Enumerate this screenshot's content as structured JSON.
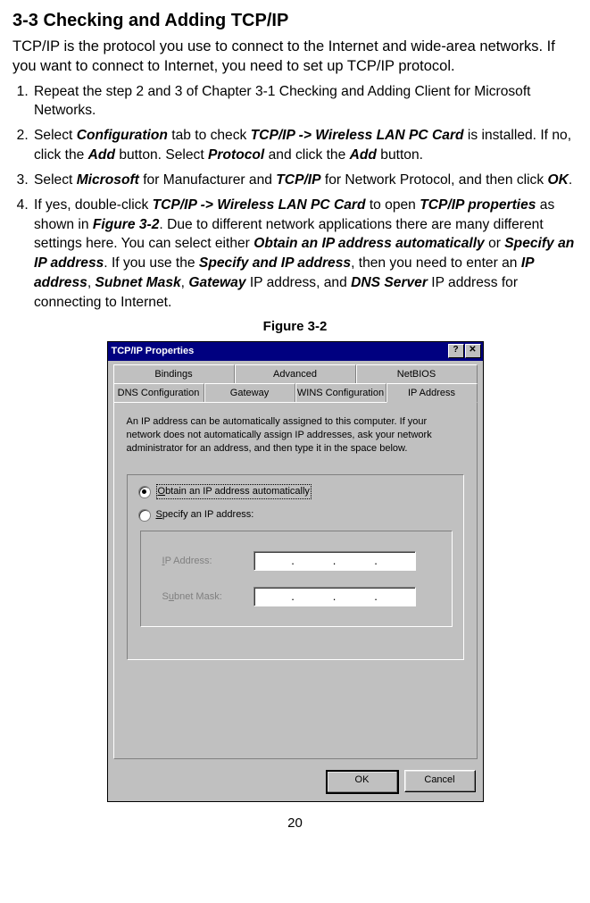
{
  "heading": "3-3 Checking and Adding TCP/IP",
  "intro": "TCP/IP is the protocol you use to connect to the Internet and wide-area networks. If you want to connect to Internet, you need to set up TCP/IP protocol.",
  "steps": {
    "s1": "Repeat the step 2 and 3 of Chapter 3-1 Checking and Adding Client for Microsoft Networks.",
    "s2_a": "Select ",
    "s2_conf": "Configuration",
    "s2_b": " tab to check ",
    "s2_tcp": "TCP/IP -> Wireless LAN PC Card",
    "s2_c": " is installed. If no, click the ",
    "s2_add1": "Add",
    "s2_d": " button. Select ",
    "s2_proto": "Protocol",
    "s2_e": " and click the ",
    "s2_add2": "Add",
    "s2_f": " button.",
    "s3_a": "Select ",
    "s3_ms": "Microsoft",
    "s3_b": " for Manufacturer and ",
    "s3_tcp": "TCP/IP",
    "s3_c": " for Network Protocol, and then click ",
    "s3_ok": "OK",
    "s3_d": ".",
    "s4_a": "If yes, double-click ",
    "s4_tcp": "TCP/IP -> Wireless LAN PC Card",
    "s4_b": " to open ",
    "s4_prop": "TCP/IP properties",
    "s4_c": " as shown in ",
    "s4_fig": "Figure 3-2",
    "s4_d": ". Due to different network applications there are many different settings here. You can select either ",
    "s4_obt": "Obtain an IP address automatically",
    "s4_e": " or ",
    "s4_spec": "Specify an IP address",
    "s4_f": ". If you use the ",
    "s4_spec2": "Specify and IP address",
    "s4_g": ", then you need to enter an ",
    "s4_ip": "IP address",
    "s4_h": ", ",
    "s4_sub": "Subnet Mask",
    "s4_i": ", ",
    "s4_gw": "Gateway",
    "s4_j": " IP address, and ",
    "s4_dns": "DNS Server",
    "s4_k": " IP address for connecting to Internet."
  },
  "figure_caption": "Figure 3-2",
  "dialog": {
    "title": "TCP/IP Properties",
    "help_btn": "?",
    "close_btn": "✕",
    "tabs_row1": [
      "Bindings",
      "Advanced",
      "NetBIOS"
    ],
    "tabs_row2": [
      "DNS Configuration",
      "Gateway",
      "WINS Configuration",
      "IP Address"
    ],
    "active_tab": "IP Address",
    "desc": "An IP address can be automatically assigned to this computer. If your network does not automatically assign IP addresses, ask your network administrator for an address, and then type it in the space below.",
    "radio_obtain_pre": "O",
    "radio_obtain": "btain an IP address automatically",
    "radio_specify_pre": "S",
    "radio_specify": "pecify an IP address:",
    "ip_label_pre": "I",
    "ip_label": "P Address:",
    "subnet_label_pre1": "S",
    "subnet_label_mid": "u",
    "subnet_label": "bnet Mask:",
    "ok_button": "OK",
    "cancel_button": "Cancel"
  },
  "page_number": "20"
}
